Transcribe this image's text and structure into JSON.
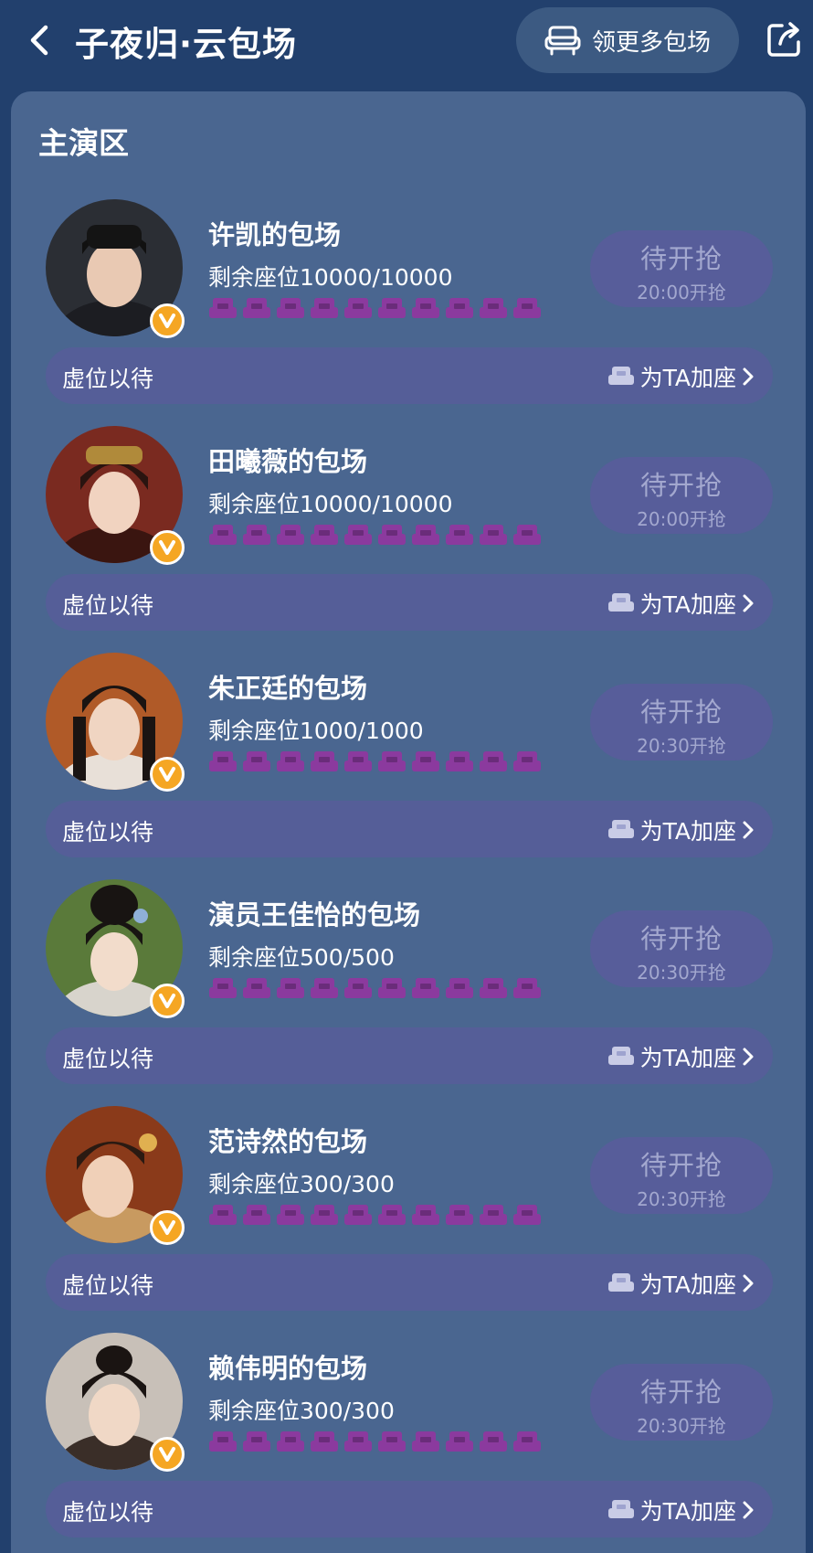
{
  "header": {
    "title": "子夜归·云包场",
    "more_label": "领更多包场",
    "back_icon": "chevron-left-icon",
    "share_icon": "share-icon",
    "more_icon": "seat-icon"
  },
  "section": {
    "title": "主演区"
  },
  "colors": {
    "background": "#22406d",
    "panel": "#4a6690",
    "button": "#575d9a",
    "bar": "#555e98",
    "seat": "#8b3a9e",
    "badge": "#f5a623"
  },
  "entries": [
    {
      "title": "许凯的包场",
      "seats": "剩余座位10000/10000",
      "grab_main": "待开抢",
      "grab_time": "20:00开抢",
      "bar_left": "虚位以待",
      "bar_right": "为TA加座"
    },
    {
      "title": "田曦薇的包场",
      "seats": "剩余座位10000/10000",
      "grab_main": "待开抢",
      "grab_time": "20:00开抢",
      "bar_left": "虚位以待",
      "bar_right": "为TA加座"
    },
    {
      "title": "朱正廷的包场",
      "seats": "剩余座位1000/1000",
      "grab_main": "待开抢",
      "grab_time": "20:30开抢",
      "bar_left": "虚位以待",
      "bar_right": "为TA加座"
    },
    {
      "title": "演员王佳怡的包场",
      "seats": "剩余座位500/500",
      "grab_main": "待开抢",
      "grab_time": "20:30开抢",
      "bar_left": "虚位以待",
      "bar_right": "为TA加座"
    },
    {
      "title": "范诗然的包场",
      "seats": "剩余座位300/300",
      "grab_main": "待开抢",
      "grab_time": "20:30开抢",
      "bar_left": "虚位以待",
      "bar_right": "为TA加座"
    },
    {
      "title": "赖伟明的包场",
      "seats": "剩余座位300/300",
      "grab_main": "待开抢",
      "grab_time": "20:30开抢",
      "bar_left": "虚位以待",
      "bar_right": "为TA加座"
    }
  ]
}
